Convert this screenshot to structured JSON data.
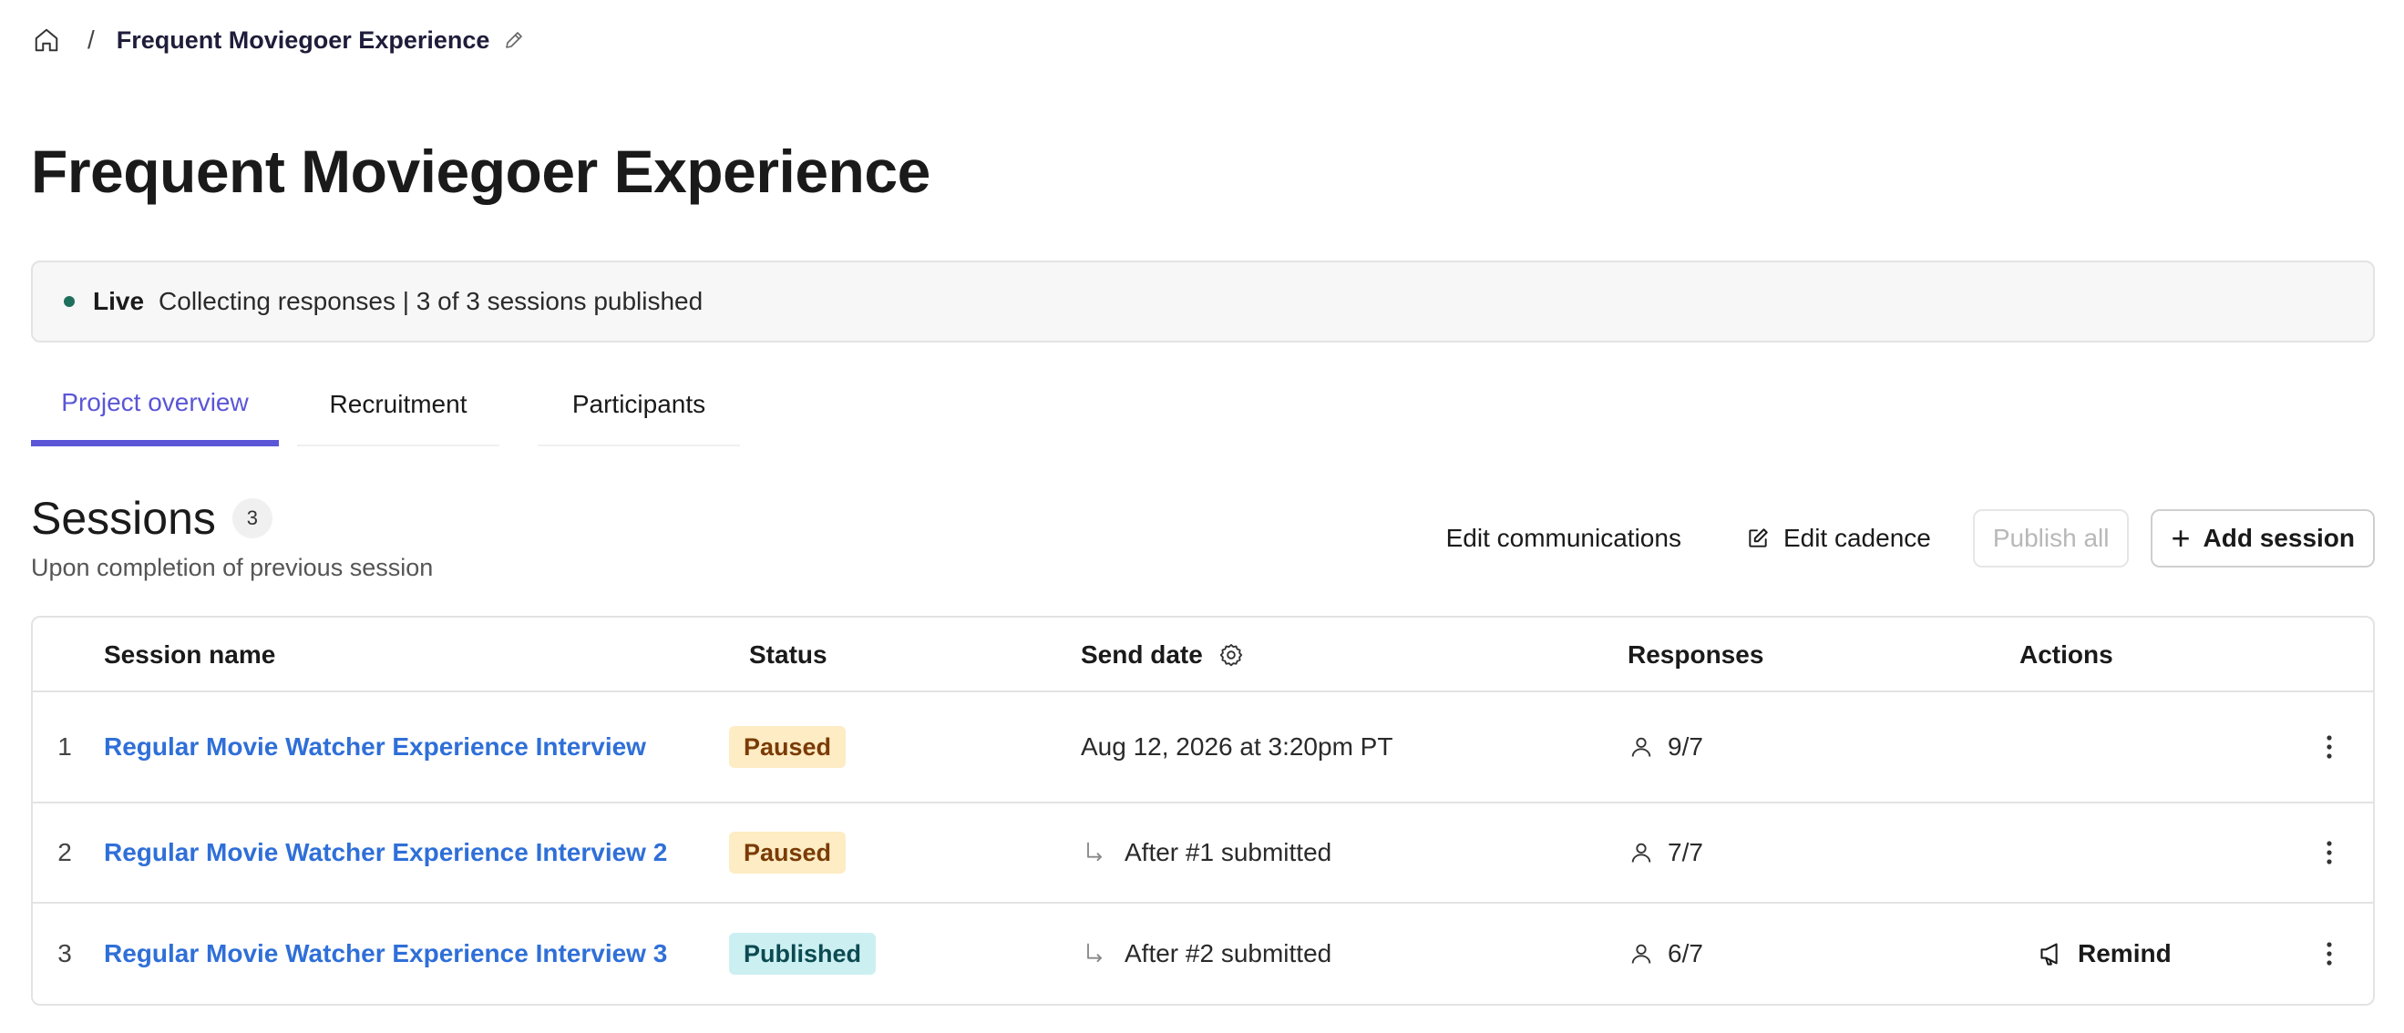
{
  "breadcrumb": {
    "home_icon": "home-icon",
    "separator": "/",
    "current": "Frequent Moviegoer Experience",
    "edit_icon": "pencil-icon"
  },
  "page": {
    "title": "Frequent Moviegoer Experience"
  },
  "status_banner": {
    "label": "Live",
    "text": "Collecting responses | 3 of 3 sessions published",
    "dot_color": "#1f6f5c"
  },
  "tabs": [
    {
      "label": "Project overview",
      "active": true
    },
    {
      "label": "Recruitment",
      "active": false
    },
    {
      "label": "Participants",
      "active": false
    }
  ],
  "accent_color": "#5a56d6",
  "sessions": {
    "title": "Sessions",
    "count": "3",
    "subtitle": "Upon completion of previous session",
    "toolbar": {
      "edit_communications": "Edit communications",
      "edit_cadence": "Edit cadence",
      "publish_all": "Publish all",
      "add_session": "Add session"
    },
    "columns": {
      "name": "Session name",
      "status": "Status",
      "send_date": "Send date",
      "responses": "Responses",
      "actions": "Actions"
    },
    "rows": [
      {
        "index": "1",
        "name": "Regular Movie Watcher Experience Interview",
        "status": "Paused",
        "status_type": "paused",
        "send_date": "Aug 12, 2026 at 3:20pm PT",
        "send_date_is_relative": false,
        "responses": "9/7",
        "action": ""
      },
      {
        "index": "2",
        "name": "Regular Movie Watcher Experience Interview 2",
        "status": "Paused",
        "status_type": "paused",
        "send_date": "After #1 submitted",
        "send_date_is_relative": true,
        "responses": "7/7",
        "action": ""
      },
      {
        "index": "3",
        "name": "Regular Movie Watcher Experience Interview 3",
        "status": "Published",
        "status_type": "published",
        "send_date": "After #2 submitted",
        "send_date_is_relative": true,
        "responses": "6/7",
        "action": "Remind"
      }
    ]
  }
}
